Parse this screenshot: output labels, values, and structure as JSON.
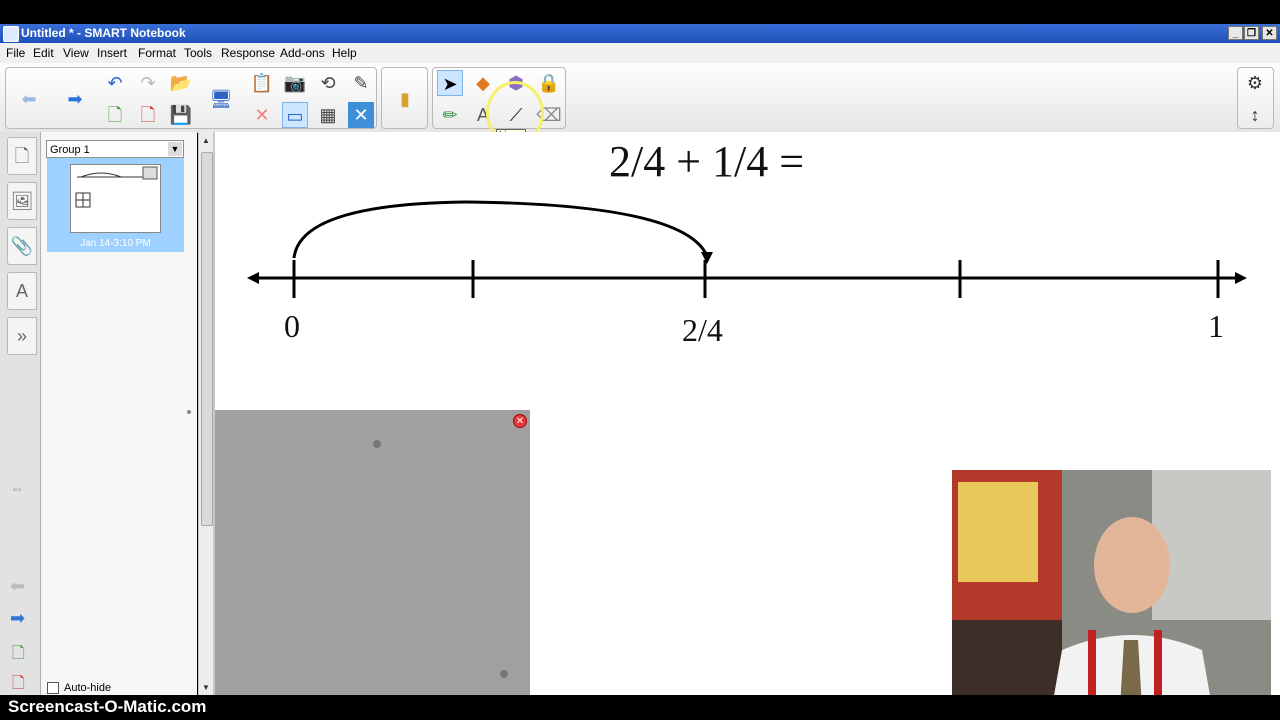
{
  "window": {
    "title": "Untitled * - SMART Notebook"
  },
  "menu": [
    "File",
    "Edit",
    "View",
    "Insert",
    "Format",
    "Tools",
    "Response",
    "Add-ons",
    "Help"
  ],
  "tooltip": "Lines",
  "sorter": {
    "group": "Group 1",
    "thumb_date": "Jan 14-3:10 PM",
    "autohide": "Auto-hide"
  },
  "canvas": {
    "equation": "2/4 + 1/4 =",
    "labels": {
      "zero": "0",
      "mid": "2/4",
      "one": "1"
    }
  },
  "footer": {
    "brand": "Screencast-O-Matic.com"
  },
  "colors": {
    "titlebar": "#2b5fcc",
    "selection": "#9ed1ff",
    "close": "#e23b3b"
  }
}
